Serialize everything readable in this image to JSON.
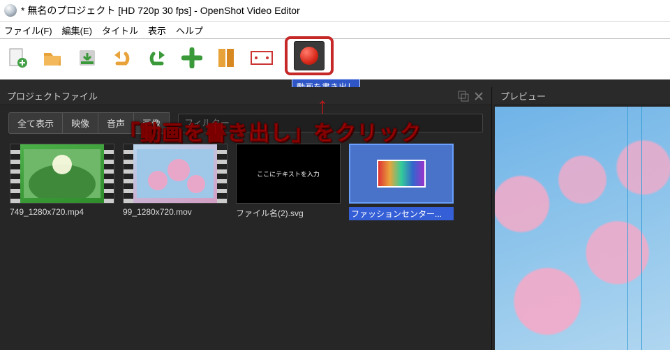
{
  "window": {
    "title": "* 無名のプロジェクト [HD 720p 30 fps] - OpenShot Video Editor"
  },
  "menu": {
    "file": "ファイル(F)",
    "edit": "編集(E)",
    "title": "タイトル",
    "view": "表示",
    "help": "ヘルプ"
  },
  "tooltip": {
    "export": "動画を書き出し"
  },
  "panels": {
    "project_files": "プロジェクトファイル",
    "preview": "プレビュー"
  },
  "tabs": {
    "all": "全て表示",
    "video": "映像",
    "audio": "音声",
    "image": "画像"
  },
  "filter": {
    "placeholder": "フィルター"
  },
  "files": [
    {
      "label": "749_1280x720.mp4"
    },
    {
      "label": "99_1280x720.mov"
    },
    {
      "label": "ファイル名(2).svg",
      "center_text": "ここにテキストを入力"
    },
    {
      "label": "ファッションセンター...",
      "selected": true
    }
  ],
  "annotation": {
    "arrow": "↑",
    "text": "「動画を書き出し」をクリック"
  }
}
